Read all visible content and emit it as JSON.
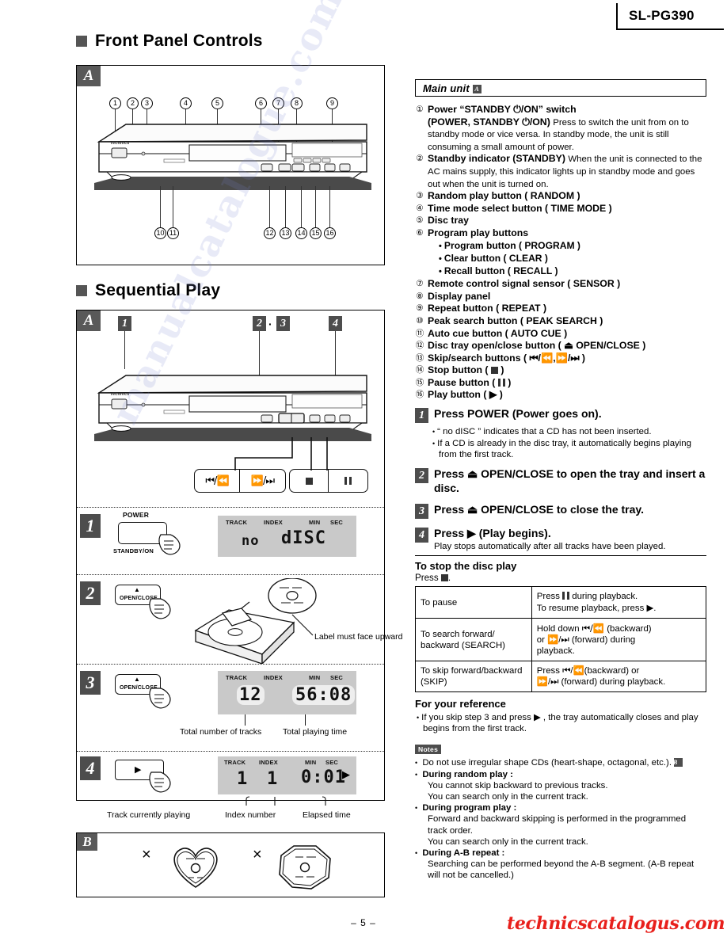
{
  "header": {
    "model": "SL-PG390"
  },
  "footer": {
    "page": "– 5 –",
    "watermark": "technicscatalogus.com"
  },
  "left": {
    "section1_title": "Front Panel Controls",
    "section2_title": "Sequential Play",
    "figure_a_tag": "A",
    "figure_b_tag": "B",
    "callouts_top": [
      "1",
      "2",
      "3",
      "4",
      "5",
      "6",
      "7",
      "8",
      "9"
    ],
    "callouts_bottom": [
      "10",
      "11",
      "12",
      "13",
      "14",
      "15",
      "16"
    ],
    "seq_markers": {
      "m1": "1",
      "m23_left": "2",
      "m23_dot": "·",
      "m23_right": "3",
      "m4": "4"
    },
    "transport_buttons": [
      "skip-back",
      "skip-fwd",
      "stop",
      "pause"
    ],
    "device_brand": "Technics",
    "steps": [
      {
        "num": "1",
        "button_label_top": "POWER",
        "button_label_bottom": "STANDBY/ON",
        "lcd": {
          "labels": [
            "TRACK",
            "INDEX",
            "MIN",
            "SEC"
          ],
          "value_left": "no",
          "value_right": "dISC"
        }
      },
      {
        "num": "2",
        "button_label": "OPEN/CLOSE",
        "note": "Label must face upward"
      },
      {
        "num": "3",
        "button_label": "OPEN/CLOSE",
        "lcd": {
          "labels": [
            "TRACK",
            "INDEX",
            "MIN",
            "SEC"
          ],
          "track": "12",
          "time": "56:08"
        },
        "caption_left": "Total number of tracks",
        "caption_right": "Total playing time"
      },
      {
        "num": "4",
        "button_label": "play",
        "lcd": {
          "labels": [
            "TRACK",
            "INDEX",
            "MIN",
            "SEC"
          ],
          "track": "1",
          "index": "1",
          "time": "0:01"
        },
        "caption_1": "Track currently playing",
        "caption_2": "Index number",
        "caption_3": "Elapsed time"
      }
    ],
    "figure_b": {
      "shape1": "heart-shaped-cd",
      "shape2": "octagonal-cd",
      "mark": "×"
    }
  },
  "right": {
    "main_unit_header": "Main unit",
    "main_unit_tag": "A",
    "items": [
      {
        "n": "①",
        "title": "Power “STANDBY ⏻/ON” switch",
        "title2": "(POWER, STANDBY ⏻/ON)",
        "desc": "Press to switch the unit from on to standby mode or vice versa. In standby mode, the unit is still consuming a small amount of power."
      },
      {
        "n": "②",
        "title": "Standby indicator (STANDBY)",
        "desc": "When the unit is connected to the AC mains supply, this indicator lights up in standby mode and goes out when the unit is turned on."
      },
      {
        "n": "③",
        "title": "Random play button ( RANDOM )"
      },
      {
        "n": "④",
        "title": "Time mode select button ( TIME MODE )"
      },
      {
        "n": "⑤",
        "title": "Disc tray"
      },
      {
        "n": "⑥",
        "title": "Program play buttons",
        "subitems": [
          "Program button ( PROGRAM )",
          "Clear button ( CLEAR )",
          "Recall button ( RECALL )"
        ]
      },
      {
        "n": "⑦",
        "title": "Remote control signal sensor ( SENSOR )"
      },
      {
        "n": "⑧",
        "title": "Display panel"
      },
      {
        "n": "⑨",
        "title": "Repeat button ( REPEAT )"
      },
      {
        "n": "⑩",
        "title": "Peak search button ( PEAK SEARCH )"
      },
      {
        "n": "⑪",
        "title": "Auto cue button ( AUTO CUE )"
      },
      {
        "n": "⑫",
        "title": "Disc tray open/close button ( ⏏ OPEN/CLOSE )"
      },
      {
        "n": "⑬",
        "title": "Skip/search buttons ( ⏮/⏪,⏩/⏭ )"
      },
      {
        "n": "⑭",
        "title": "Stop button (  )"
      },
      {
        "n": "⑮",
        "title": "Pause button (  )"
      },
      {
        "n": "⑯",
        "title": "Play button ( ▶ )"
      }
    ],
    "steps": [
      {
        "num": "1",
        "text": "Press POWER (Power goes on).",
        "bullets": [
          "“ no dISC ” indicates that a CD has not been inserted.",
          "If a CD is already in the disc tray, it automatically begins playing from the first track."
        ]
      },
      {
        "num": "2",
        "text": "Press ⏏ OPEN/CLOSE to open the tray and insert a disc."
      },
      {
        "num": "3",
        "text": "Press ⏏ OPEN/CLOSE to close the tray."
      },
      {
        "num": "4",
        "text": "Press ▶ (Play begins).",
        "sub": "Play stops automatically after all tracks have been played."
      }
    ],
    "stop_heading": "To stop the disc play",
    "stop_press_prefix": "Press",
    "stop_press_suffix": ".",
    "table": [
      {
        "action": "To pause",
        "how_line1_pre": "Press",
        "how_line1_post": "during playback.",
        "how_line2_pre": "To resume playback, press",
        "how_line2_post": "."
      },
      {
        "action": "To search forward/ backward (SEARCH)",
        "how_line1_pre": "Hold down",
        "how_line1_mid": "⏮/⏪",
        "how_line1_post": "(backward)",
        "how_line2": "or ⏩/⏭ (forward) during",
        "how_line3": "playback."
      },
      {
        "action": "To skip forward/backward (SKIP)",
        "how_line1": "Press ⏮/⏪(backward) or",
        "how_line2": "⏩/⏭ (forward) during playback."
      }
    ],
    "reference_heading": "For your reference",
    "reference_bullets": [
      "If you skip step 3 and press ▶ , the tray automatically closes and play begins from the first track."
    ],
    "notes_tag": "Notes",
    "notes": [
      {
        "bullet": true,
        "text": "Do not use irregular shape CDs (heart-shape, octagonal, etc.).",
        "tag": "B"
      },
      {
        "bullet": true,
        "label": "During random play :",
        "lines": [
          "You cannot skip backward to previous tracks.",
          "You can search only in the current track."
        ]
      },
      {
        "bullet": true,
        "label": "During program play :",
        "lines": [
          "Forward and backward skipping is performed in the programmed track  order.",
          "You can search only in the current track."
        ]
      },
      {
        "bullet": true,
        "label": "During A-B repeat :",
        "lines": [
          "Searching can be performed beyond the A-B segment. (A-B repeat will not be cancelled.)"
        ]
      }
    ]
  }
}
